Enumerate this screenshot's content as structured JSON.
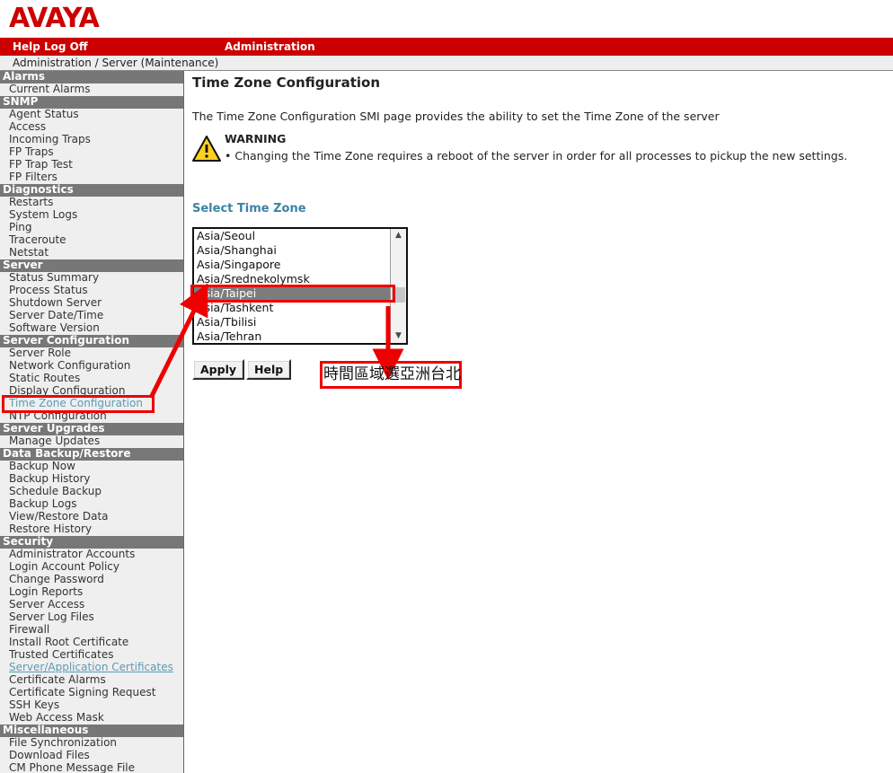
{
  "brand": {
    "logo_text": "AVAYA",
    "logo_color": "#cc0000"
  },
  "menubar": {
    "help": "Help",
    "log_off": "Log Off",
    "administration": "Administration"
  },
  "breadcrumb": {
    "text": "Administration / Server (Maintenance)"
  },
  "sidebar": {
    "groups": [
      {
        "title": "Alarms",
        "items": [
          "Current Alarms"
        ]
      },
      {
        "title": "SNMP",
        "items": [
          "Agent Status",
          "Access",
          "Incoming Traps",
          "FP Traps",
          "FP Trap Test",
          "FP Filters"
        ]
      },
      {
        "title": "Diagnostics",
        "items": [
          "Restarts",
          "System Logs",
          "Ping",
          "Traceroute",
          "Netstat"
        ]
      },
      {
        "title": "Server",
        "items": [
          "Status Summary",
          "Process Status",
          "Shutdown Server",
          "Server Date/Time",
          "Software Version"
        ]
      },
      {
        "title": "Server Configuration",
        "items": [
          "Server Role",
          "Network Configuration",
          "Static Routes",
          "Display Configuration",
          "Time Zone Configuration",
          "NTP Configuration"
        ]
      },
      {
        "title": "Server Upgrades",
        "items": [
          "Manage Updates"
        ]
      },
      {
        "title": "Data Backup/Restore",
        "items": [
          "Backup Now",
          "Backup History",
          "Schedule Backup",
          "Backup Logs",
          "View/Restore Data",
          "Restore History"
        ]
      },
      {
        "title": "Security",
        "items": [
          "Administrator Accounts",
          "Login Account Policy",
          "Change Password",
          "Login Reports",
          "Server Access",
          "Server Log Files",
          "Firewall",
          "Install Root Certificate",
          "Trusted Certificates",
          "Server/Application Certificates",
          "Certificate Alarms",
          "Certificate Signing Request",
          "SSH Keys",
          "Web Access Mask"
        ]
      },
      {
        "title": "Miscellaneous",
        "items": [
          "File Synchronization",
          "Download Files",
          "CM Phone Message File"
        ]
      }
    ],
    "active_item": "Time Zone Configuration",
    "visited_item": "Server/Application Certificates",
    "active_color": "#5b9bb5"
  },
  "main": {
    "title": "Time Zone Configuration",
    "intro": "The Time Zone Configuration SMI page provides the ability to set the Time Zone of the server",
    "warning_title": "WARNING",
    "warning_text": "Changing the Time Zone requires a reboot of the server in order for all processes to pickup the new settings.",
    "select_label": "Select Time Zone",
    "timezones": [
      "Asia/Seoul",
      "Asia/Shanghai",
      "Asia/Singapore",
      "Asia/Srednekolymsk",
      "Asia/Taipei",
      "Asia/Tashkent",
      "Asia/Tbilisi",
      "Asia/Tehran"
    ],
    "selected_timezone": "Asia/Taipei",
    "apply_label": "Apply",
    "help_label": "Help"
  },
  "annotations": {
    "callout_text": "時間區域選亞洲台北",
    "highlight_color": "#ee0000"
  }
}
